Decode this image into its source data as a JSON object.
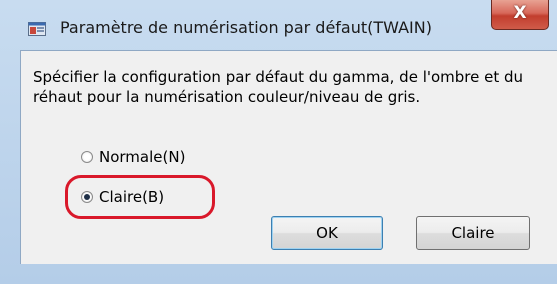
{
  "window": {
    "title": "Paramètre de numérisation par défaut(TWAIN)",
    "close_glyph": "X"
  },
  "dialog": {
    "description": "Spécifier la configuration par défaut du gamma, de l'ombre et du réhaut pour la numérisation couleur/niveau de gris.",
    "options": [
      {
        "label": "Normale(N)",
        "checked": false
      },
      {
        "label": "Claire(B)",
        "checked": true
      }
    ],
    "ok_label": "OK",
    "claire_label": "Claire"
  },
  "colors": {
    "highlight": "#d9182a",
    "close_button": "#c23e2e"
  }
}
